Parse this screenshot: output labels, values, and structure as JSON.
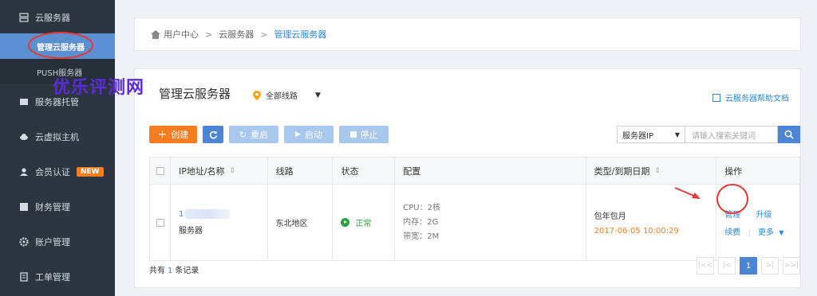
{
  "sidebar": {
    "items": [
      {
        "label": "云服务器",
        "icon": "server-icon"
      },
      {
        "label": "服务器托管",
        "icon": "rack-icon"
      },
      {
        "label": "云虚拟主机",
        "icon": "cloud-icon"
      },
      {
        "label": "会员认证",
        "icon": "user-icon",
        "badge": "NEW"
      },
      {
        "label": "财务管理",
        "icon": "wallet-icon"
      },
      {
        "label": "账户管理",
        "icon": "gear-icon"
      },
      {
        "label": "工单管理",
        "icon": "ticket-icon"
      }
    ],
    "subitems": [
      {
        "label": "管理云服务器",
        "active": true
      },
      {
        "label": "PUSH服务器",
        "active": false
      }
    ]
  },
  "watermark": "优乐评测网",
  "breadcrumb": {
    "home": "用户中心",
    "sep": ">",
    "level2": "云服务器",
    "current": "管理云服务器"
  },
  "page": {
    "title": "管理云服务器",
    "region": "全部线路",
    "help": "云服务器帮助文档"
  },
  "toolbar": {
    "create": "创建",
    "restart": "重启",
    "start": "启动",
    "stop": "停止"
  },
  "search": {
    "select": "服务器IP",
    "placeholder": "请输入搜索关键词"
  },
  "table": {
    "headers": [
      "IP地址/名称",
      "线路",
      "状态",
      "配置",
      "类型/到期日期",
      "操作"
    ],
    "rows": [
      {
        "ip": "1",
        "name": "服务器",
        "line": "东北地区",
        "status": "正常",
        "cpu": "CPU：2核",
        "mem": "内存：2G",
        "bw": "带宽：2M",
        "type": "包年包月",
        "expire": "2017-06-05 10:00:29",
        "actions": {
          "manage": "管理",
          "upgrade": "升级",
          "renew": "续费",
          "more": "更多"
        }
      }
    ]
  },
  "footer": {
    "prefix": "共有",
    "count": "1",
    "suffix": "条记录",
    "current_page": "1"
  },
  "colors": {
    "sidebar_bg": "#2c3540",
    "active_blue": "#5b8fd1",
    "accent_orange": "#f57c1f",
    "link_blue": "#2b8ae5",
    "status_green": "#2aa13a",
    "annotation_red": "#e53935"
  }
}
